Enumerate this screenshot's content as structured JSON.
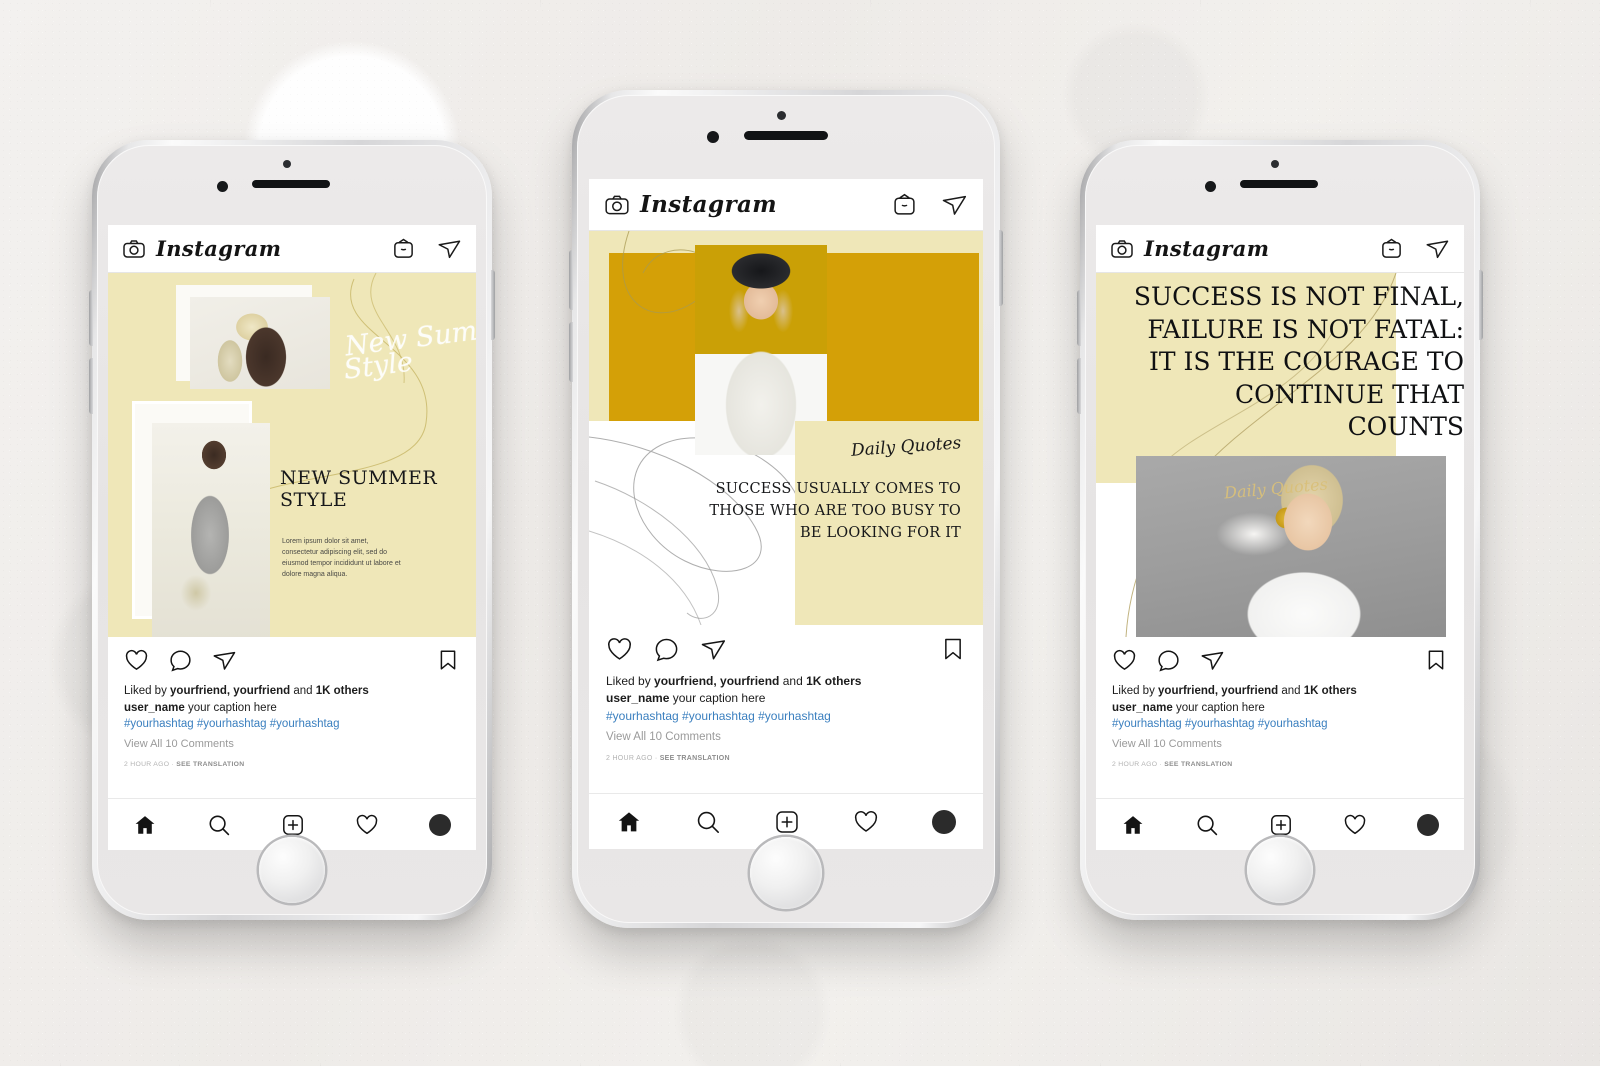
{
  "scene": {
    "title": "Instagram post mockups on three smartphones",
    "background_color": "#efecea",
    "phone_body_color": "#e8e6e6",
    "accent_cream": "#EFE7B8",
    "accent_gold": "#D4A007",
    "link_blue": "#3a7fbf"
  },
  "instagram": {
    "wordmark": "Instagram",
    "top_icons": [
      "camera-icon",
      "igtv-icon",
      "share-icon"
    ],
    "action_icons": [
      "heart-icon",
      "comment-icon",
      "share-icon",
      "bookmark-icon"
    ],
    "nav_icons": [
      "home-icon",
      "search-icon",
      "add-post-icon",
      "activity-icon",
      "profile-avatar"
    ]
  },
  "caption": {
    "liked_prefix": "Liked by ",
    "liked_friend_1": "yourfriend,",
    "liked_friend_2": "yourfriend",
    "liked_and": " and ",
    "liked_others": "1K others",
    "username": "user_name",
    "text": "your caption here",
    "hashtags": "#yourhashtag #yourhashtag #yourhashtag",
    "view_comments": "View All 10 Comments",
    "timestamp": "2 HOUR AGO",
    "timestamp_sep": " · ",
    "see_translation": "SEE TRANSLATION"
  },
  "posts": [
    {
      "id": "new-summer-style",
      "script_line_1": "New Summer",
      "script_line_2": "Style",
      "headline_line_1": "NEW SUMMER",
      "headline_line_2": "STYLE",
      "body": "Lorem ipsum dolor sit amet, consectetur adipiscing elit, sed do eiusmod tempor incididunt ut labore et dolore magna aliqua.",
      "bg_color": "#EFE7B8"
    },
    {
      "id": "daily-quotes",
      "script": "Daily Quotes",
      "quote_line_1": "SUCCESS USUALLY COMES TO",
      "quote_line_2": "THOSE WHO ARE TOO BUSY TO",
      "quote_line_3": "BE LOOKING FOR IT",
      "bg_color": "#ffffff",
      "band_color": "#EFE7B8",
      "gold_color": "#D4A007"
    },
    {
      "id": "success-is-not-final",
      "script": "Daily Quotes",
      "quote_line_1": "SUCCESS IS NOT FINAL,",
      "quote_line_2": "FAILURE IS NOT FATAL:",
      "quote_line_3": "IT IS THE COURAGE TO",
      "quote_line_4": "CONTINUE THAT",
      "quote_line_5": "COUNTS",
      "bg_color": "#ffffff",
      "band_color": "#EFE7B8"
    }
  ]
}
